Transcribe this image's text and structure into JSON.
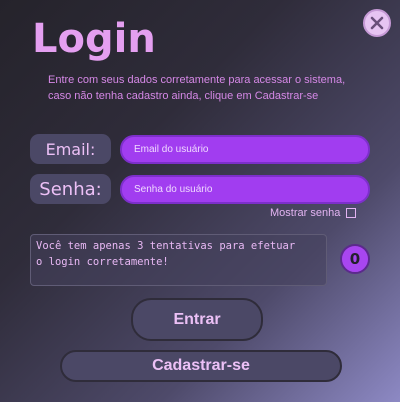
{
  "header": {
    "title": "Login",
    "close_icon": "close-icon"
  },
  "intro": {
    "line1": "Entre com seus dados corretamente para acessar o sistema,",
    "line2": "caso não tenha cadastro ainda, clique em Cadastrar-se"
  },
  "form": {
    "email_label": "Email:",
    "email_placeholder": "Email do usuário",
    "password_label": "Senha:",
    "password_placeholder": "Senha do usuário",
    "show_password_label": "Mostrar senha",
    "show_password_checked": false
  },
  "attempts": {
    "message": "Você tem apenas 3 tentativas para efetuar\no login corretamente!",
    "count": "0"
  },
  "actions": {
    "enter_label": "Entrar",
    "register_label": "Cadastrar-se"
  },
  "colors": {
    "title": "#e49ff0",
    "field_bg": "#a13df0",
    "pill_bg": "#4b4866"
  }
}
